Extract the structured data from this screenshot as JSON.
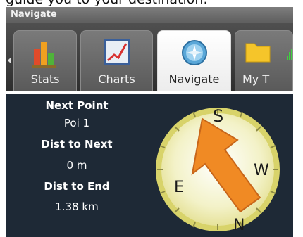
{
  "caption": {
    "text": "guide you to your destination."
  },
  "window": {
    "title": "Navigate"
  },
  "tabs": [
    {
      "label": "Stats",
      "icon": "bar-chart-icon",
      "active": false
    },
    {
      "label": "Charts",
      "icon": "line-chart-icon",
      "active": false
    },
    {
      "label": "Navigate",
      "icon": "compass-icon",
      "active": true
    },
    {
      "label": "My T",
      "icon": "folder-icon",
      "active": false
    }
  ],
  "status": {
    "signal_icon": "signal-strength-icon"
  },
  "navigation": {
    "next_point_label": "Next Point",
    "next_point_value": "Poi 1",
    "dist_to_next_label": "Dist to Next",
    "dist_to_next_value": "0 m",
    "dist_to_end_label": "Dist to End",
    "dist_to_end_value": "1.38 km"
  },
  "compass": {
    "labels": {
      "s": "S",
      "w": "W",
      "e": "E",
      "n": "N"
    },
    "arrow_color": "#f08a24",
    "face_color": "#f3f2c8",
    "ring_color": "#d8d36a",
    "icon": "compass-arrow-icon"
  },
  "colors": {
    "background": "#1e2936",
    "tab_active": "#ffffff",
    "title_bar": "#6e6e6e"
  }
}
